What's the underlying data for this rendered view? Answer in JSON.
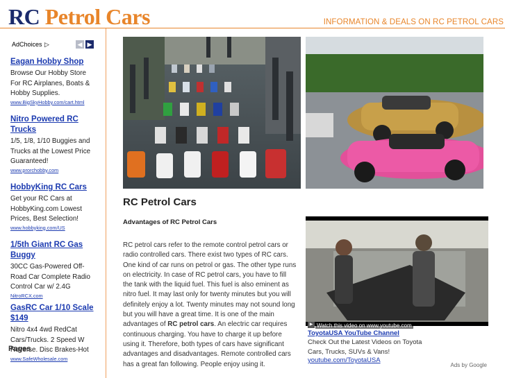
{
  "header": {
    "title_rc": "RC",
    "title_rest": "Petrol Cars",
    "tagline": "INFORMATION & DEALS ON RC PETROL CARS"
  },
  "sidebar": {
    "adchoices_label": "AdChoices",
    "prev_arrow": "◀",
    "next_arrow": "▶",
    "ads": [
      {
        "title": "Eagan Hobby Shop",
        "body": "Browse Our Hobby Store For RC Airplanes, Boats & Hobby Supplies.",
        "url": "www.BigSkyHobby.com/cart.html"
      },
      {
        "title": "Nitro Powered RC Trucks",
        "body": "1/5, 1/8, 1/10 Buggies and Trucks at the Lowest Price Guaranteed!",
        "url": "www.prorchobby.com"
      },
      {
        "title": "HobbyKing RC Cars",
        "body": "Get your RC Cars at HobbyKing.com Lowest Prices, Best Selection!",
        "url": "www.hobbyking.com/US"
      },
      {
        "title": "1/5th Giant RC Gas Buggy",
        "body": "30CC Gas-Powered Off-Road Car Complete Radio Control Car w/ 2.4G",
        "url": "NitroRCX.com"
      },
      {
        "title": "GasRC Car 1/10 Scale $149",
        "body": "Nitro 4x4 4wd RedCat Cars/Trucks. 2 Speed W Reverse. Disc Brakes-Hot",
        "url": "www.SafeWholesale.com"
      }
    ],
    "pages_heading": "Pages"
  },
  "article": {
    "title": "RC Petrol Cars",
    "subtitle": "Advantages of RC Petrol Cars",
    "body_part1": "RC petrol cars refer to the remote control petrol cars or radio controlled cars. There exist two types of RC cars. One kind of car runs on petrol or gas. The other type runs on electricity. In case of RC petrol cars, you have to fill the tank with the liquid fuel. This fuel is also eminent as nitro fuel. It may last only for twenty minutes but you will definitely enjoy a lot. Twenty minutes may not sound long but you will have a great time. It is one of the main advantages of ",
    "body_bold": "RC petrol cars",
    "body_part2": ". An electric car requires continuous charging. You have to charge it up before using it. Therefore, both types of cars have significant advantages and disadvantages. Remote controlled cars has a great fan following. People enjoy using it."
  },
  "video_ad": {
    "caption": "Watch this video on www.youtube.com",
    "title": "ToyotaUSA YouTube Channel",
    "description": "Check Out the Latest Videos on Toyota Cars, Trucks, SUVs & Vans!",
    "url": "youtube.com/ToyotaUSA",
    "ads_by": "Ads by Google"
  },
  "colors": {
    "brand_navy": "#1b2a6b",
    "brand_orange": "#e8852a",
    "link_blue": "#1b3ab0"
  }
}
